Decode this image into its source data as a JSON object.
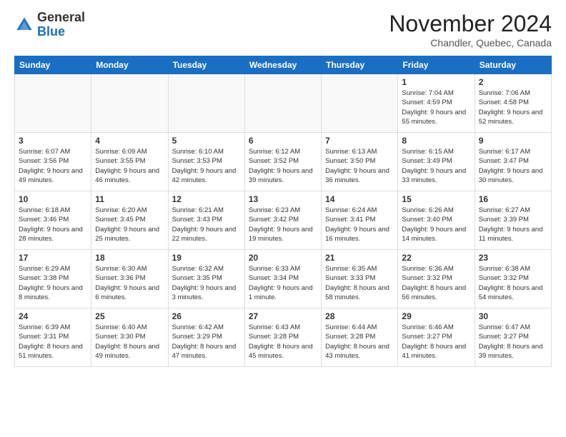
{
  "header": {
    "logo_line1": "General",
    "logo_line2": "Blue",
    "month": "November 2024",
    "location": "Chandler, Quebec, Canada"
  },
  "days_of_week": [
    "Sunday",
    "Monday",
    "Tuesday",
    "Wednesday",
    "Thursday",
    "Friday",
    "Saturday"
  ],
  "weeks": [
    [
      {
        "day": "",
        "info": ""
      },
      {
        "day": "",
        "info": ""
      },
      {
        "day": "",
        "info": ""
      },
      {
        "day": "",
        "info": ""
      },
      {
        "day": "",
        "info": ""
      },
      {
        "day": "1",
        "info": "Sunrise: 7:04 AM\nSunset: 4:59 PM\nDaylight: 9 hours and 55 minutes."
      },
      {
        "day": "2",
        "info": "Sunrise: 7:06 AM\nSunset: 4:58 PM\nDaylight: 9 hours and 52 minutes."
      }
    ],
    [
      {
        "day": "3",
        "info": "Sunrise: 6:07 AM\nSunset: 3:56 PM\nDaylight: 9 hours and 49 minutes."
      },
      {
        "day": "4",
        "info": "Sunrise: 6:09 AM\nSunset: 3:55 PM\nDaylight: 9 hours and 46 minutes."
      },
      {
        "day": "5",
        "info": "Sunrise: 6:10 AM\nSunset: 3:53 PM\nDaylight: 9 hours and 42 minutes."
      },
      {
        "day": "6",
        "info": "Sunrise: 6:12 AM\nSunset: 3:52 PM\nDaylight: 9 hours and 39 minutes."
      },
      {
        "day": "7",
        "info": "Sunrise: 6:13 AM\nSunset: 3:50 PM\nDaylight: 9 hours and 36 minutes."
      },
      {
        "day": "8",
        "info": "Sunrise: 6:15 AM\nSunset: 3:49 PM\nDaylight: 9 hours and 33 minutes."
      },
      {
        "day": "9",
        "info": "Sunrise: 6:17 AM\nSunset: 3:47 PM\nDaylight: 9 hours and 30 minutes."
      }
    ],
    [
      {
        "day": "10",
        "info": "Sunrise: 6:18 AM\nSunset: 3:46 PM\nDaylight: 9 hours and 28 minutes."
      },
      {
        "day": "11",
        "info": "Sunrise: 6:20 AM\nSunset: 3:45 PM\nDaylight: 9 hours and 25 minutes."
      },
      {
        "day": "12",
        "info": "Sunrise: 6:21 AM\nSunset: 3:43 PM\nDaylight: 9 hours and 22 minutes."
      },
      {
        "day": "13",
        "info": "Sunrise: 6:23 AM\nSunset: 3:42 PM\nDaylight: 9 hours and 19 minutes."
      },
      {
        "day": "14",
        "info": "Sunrise: 6:24 AM\nSunset: 3:41 PM\nDaylight: 9 hours and 16 minutes."
      },
      {
        "day": "15",
        "info": "Sunrise: 6:26 AM\nSunset: 3:40 PM\nDaylight: 9 hours and 14 minutes."
      },
      {
        "day": "16",
        "info": "Sunrise: 6:27 AM\nSunset: 3:39 PM\nDaylight: 9 hours and 11 minutes."
      }
    ],
    [
      {
        "day": "17",
        "info": "Sunrise: 6:29 AM\nSunset: 3:38 PM\nDaylight: 9 hours and 8 minutes."
      },
      {
        "day": "18",
        "info": "Sunrise: 6:30 AM\nSunset: 3:36 PM\nDaylight: 9 hours and 6 minutes."
      },
      {
        "day": "19",
        "info": "Sunrise: 6:32 AM\nSunset: 3:35 PM\nDaylight: 9 hours and 3 minutes."
      },
      {
        "day": "20",
        "info": "Sunrise: 6:33 AM\nSunset: 3:34 PM\nDaylight: 9 hours and 1 minute."
      },
      {
        "day": "21",
        "info": "Sunrise: 6:35 AM\nSunset: 3:33 PM\nDaylight: 8 hours and 58 minutes."
      },
      {
        "day": "22",
        "info": "Sunrise: 6:36 AM\nSunset: 3:32 PM\nDaylight: 8 hours and 56 minutes."
      },
      {
        "day": "23",
        "info": "Sunrise: 6:38 AM\nSunset: 3:32 PM\nDaylight: 8 hours and 54 minutes."
      }
    ],
    [
      {
        "day": "24",
        "info": "Sunrise: 6:39 AM\nSunset: 3:31 PM\nDaylight: 8 hours and 51 minutes."
      },
      {
        "day": "25",
        "info": "Sunrise: 6:40 AM\nSunset: 3:30 PM\nDaylight: 8 hours and 49 minutes."
      },
      {
        "day": "26",
        "info": "Sunrise: 6:42 AM\nSunset: 3:29 PM\nDaylight: 8 hours and 47 minutes."
      },
      {
        "day": "27",
        "info": "Sunrise: 6:43 AM\nSunset: 3:28 PM\nDaylight: 8 hours and 45 minutes."
      },
      {
        "day": "28",
        "info": "Sunrise: 6:44 AM\nSunset: 3:28 PM\nDaylight: 8 hours and 43 minutes."
      },
      {
        "day": "29",
        "info": "Sunrise: 6:46 AM\nSunset: 3:27 PM\nDaylight: 8 hours and 41 minutes."
      },
      {
        "day": "30",
        "info": "Sunrise: 6:47 AM\nSunset: 3:27 PM\nDaylight: 8 hours and 39 minutes."
      }
    ]
  ]
}
